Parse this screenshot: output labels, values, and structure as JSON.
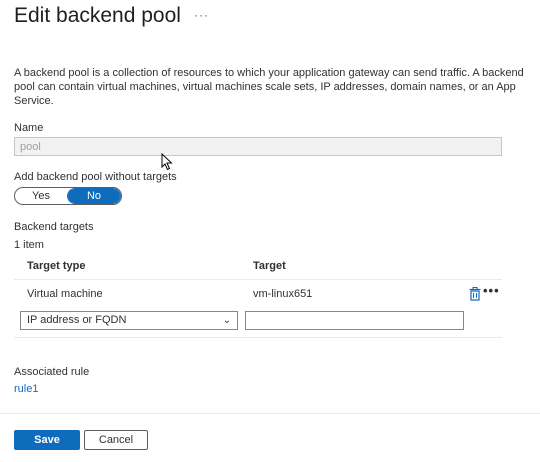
{
  "header": {
    "title": "Edit backend pool",
    "more_label": "···"
  },
  "description": "A backend pool is a collection of resources to which your application gateway can send traffic. A backend pool can contain virtual machines, virtual machines scale sets, IP addresses, domain names, or an App Service.",
  "name_field": {
    "label": "Name",
    "value": "pool"
  },
  "without_targets": {
    "label": "Add backend pool without targets",
    "options": [
      "Yes",
      "No"
    ],
    "selected": "No"
  },
  "targets": {
    "label": "Backend targets",
    "count": "1 item",
    "columns": [
      "Target type",
      "Target"
    ],
    "rows": [
      {
        "type": "Virtual machine",
        "target": "vm-linux651"
      }
    ],
    "new_row": {
      "type_value": "IP address or FQDN",
      "target_value": ""
    },
    "row_more_label": "•••"
  },
  "associated": {
    "label": "Associated rule",
    "link": "rule1"
  },
  "footer": {
    "save_label": "Save",
    "cancel_label": "Cancel"
  },
  "colors": {
    "accent": "#0f6cbd",
    "border": "#8a8886"
  }
}
